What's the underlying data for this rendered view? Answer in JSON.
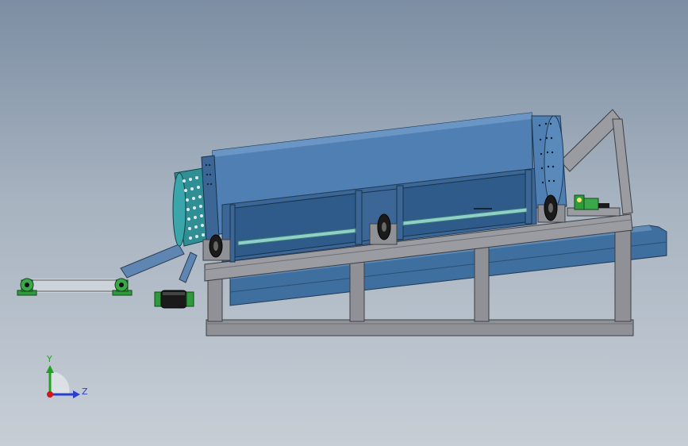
{
  "triad": {
    "y_label": "Y",
    "z_label": "Z",
    "y_color": "#22a022",
    "z_color": "#2a3fd0",
    "origin_color": "#d01818"
  },
  "colors": {
    "background_top": "#7c8ea3",
    "background_bottom": "#c7ced6",
    "drum_blue": "#4f7fb3",
    "drum_blue_dark": "#3b6696",
    "frame_gray": "#8f9196",
    "frame_gray_dark": "#5f6166",
    "mount_green": "#2e9a3c",
    "shaft_teal": "#8fd0c8",
    "screen_teal": "#2f8f95"
  }
}
